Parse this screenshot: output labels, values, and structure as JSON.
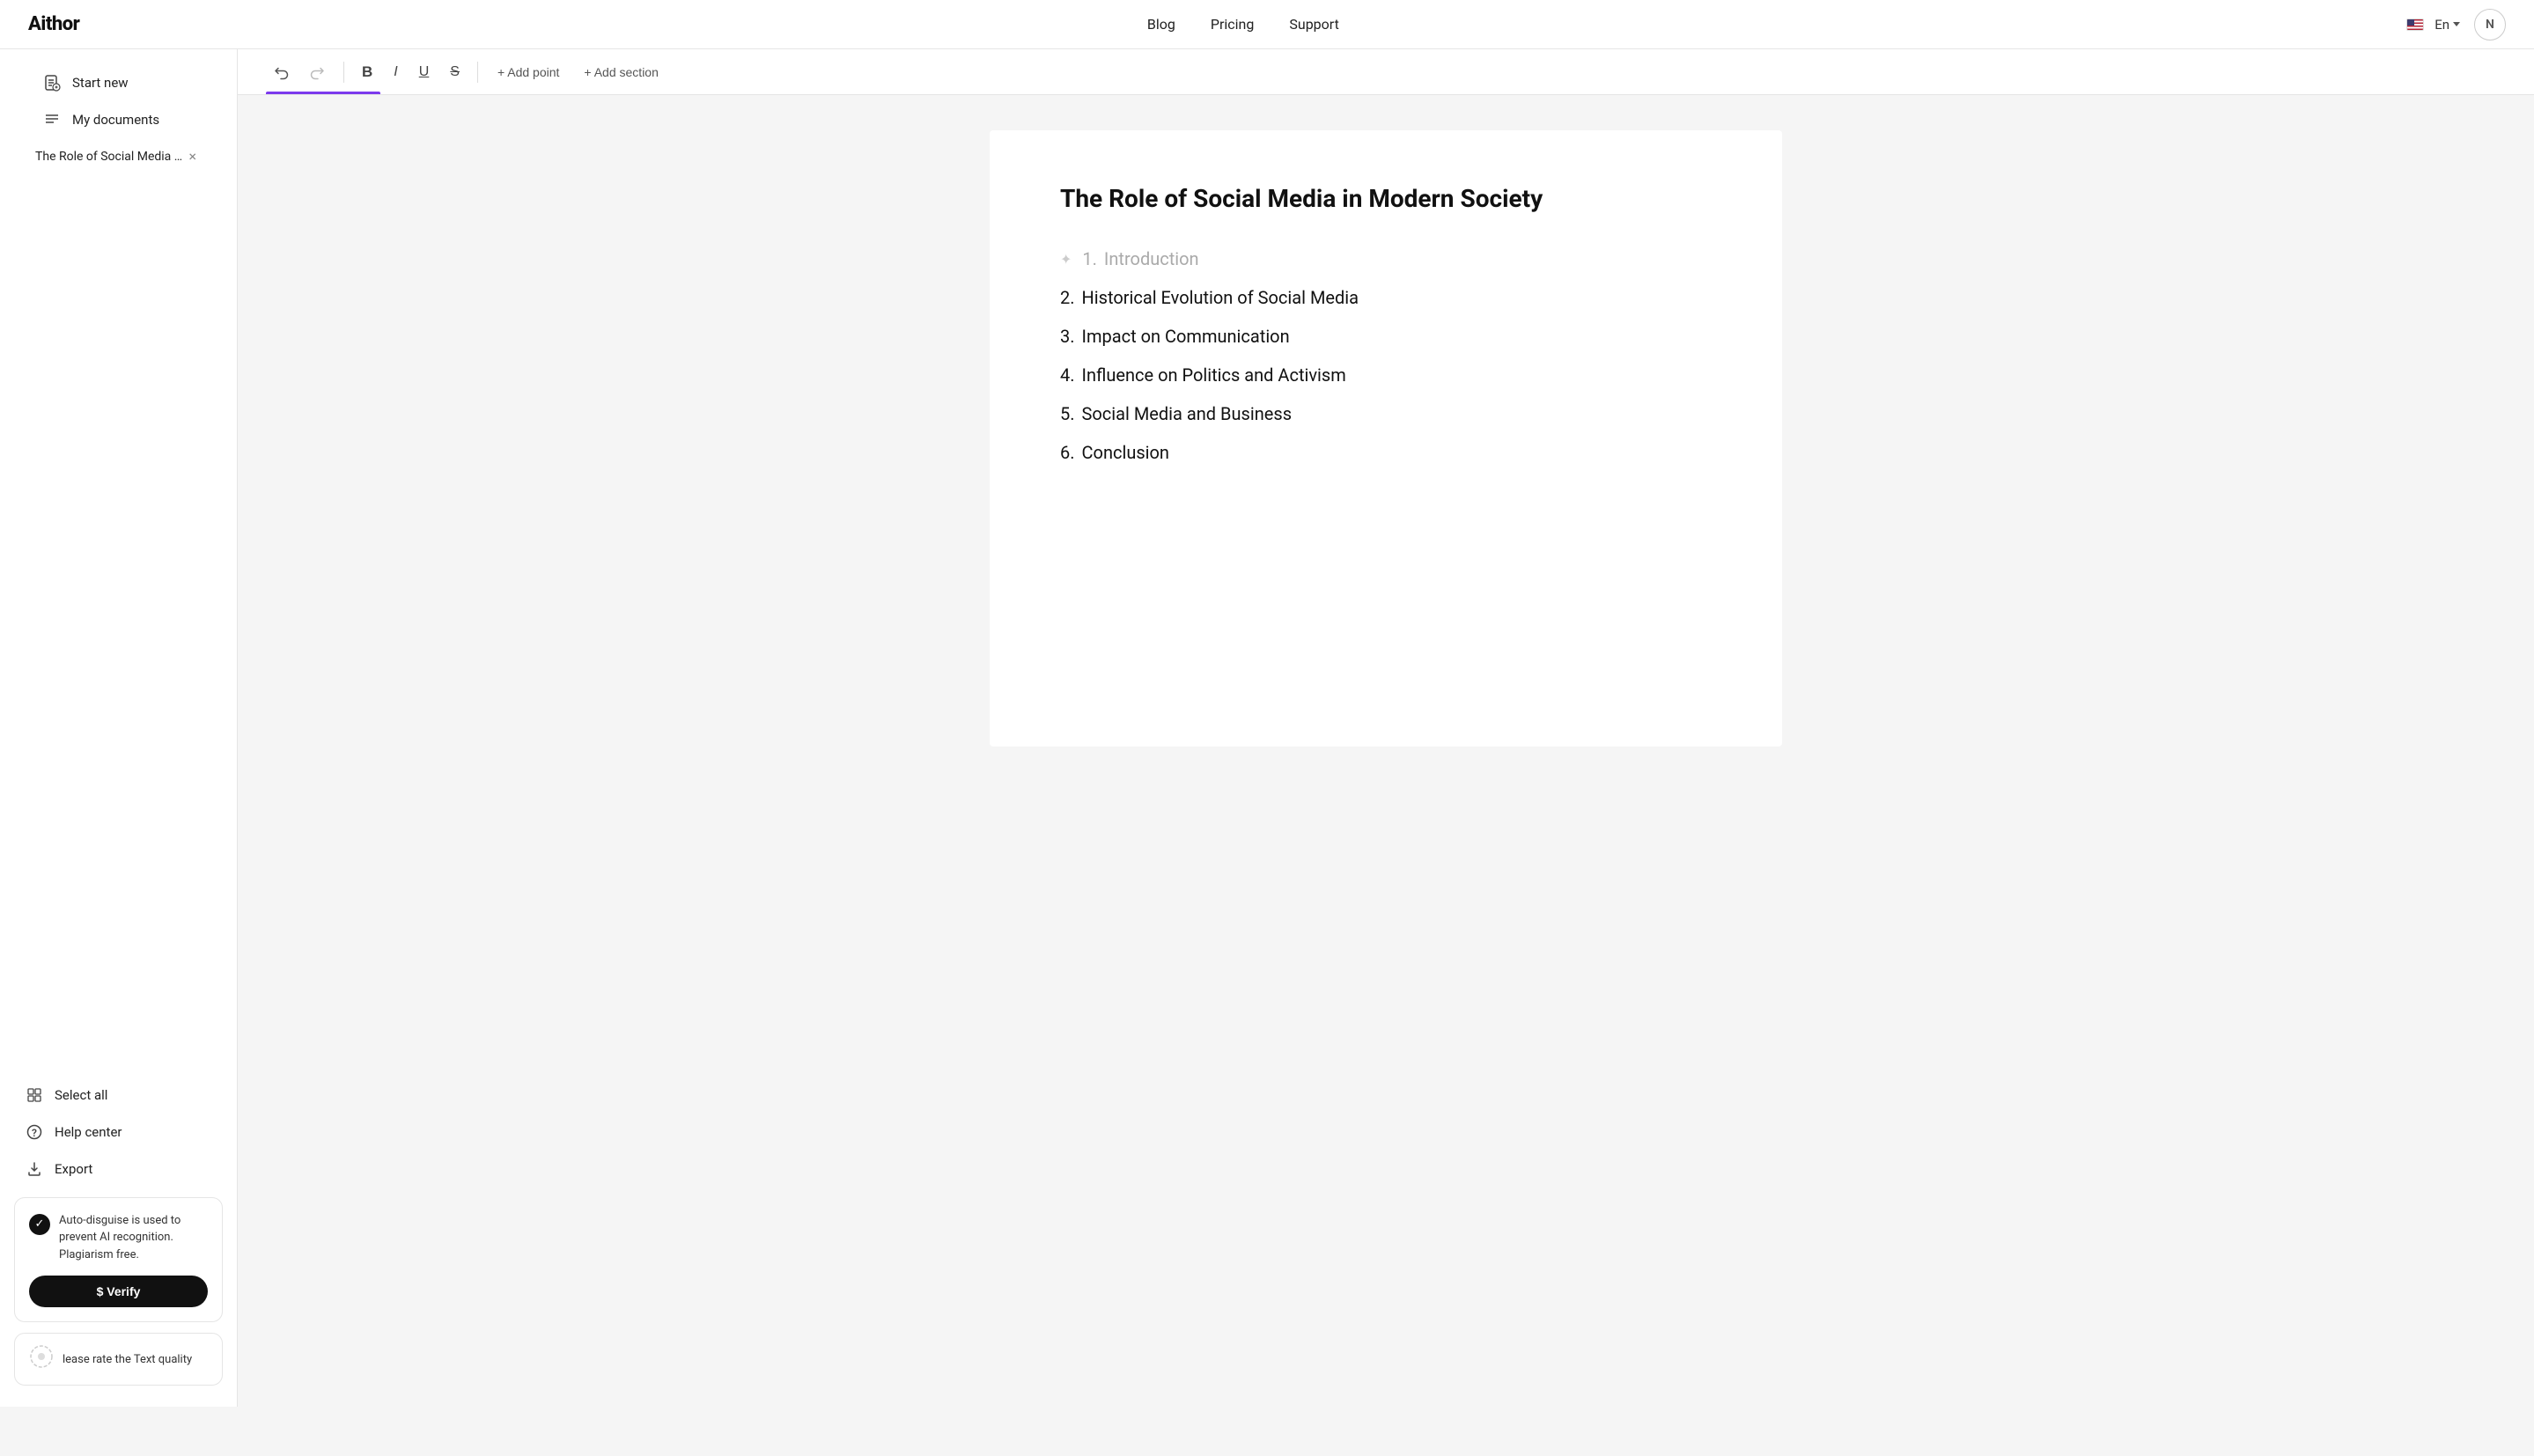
{
  "header": {
    "logo": "Aithor",
    "nav": [
      {
        "label": "Blog",
        "id": "blog"
      },
      {
        "label": "Pricing",
        "id": "pricing"
      },
      {
        "label": "Support",
        "id": "support"
      }
    ],
    "lang": "En",
    "user_initial": "N"
  },
  "sidebar": {
    "start_new_label": "Start new",
    "my_documents_label": "My documents",
    "open_doc_title": "The Role of Social Media i...",
    "select_all_label": "Select all",
    "help_center_label": "Help center",
    "export_label": "Export",
    "info_card": {
      "text": "Auto-disguise is used to prevent AI recognition. Plagiarism free.",
      "verify_btn": "$ Verify"
    },
    "rating_card": {
      "text": "lease rate the Text quality"
    }
  },
  "toolbar": {
    "undo_label": "↩",
    "redo_label": "↪",
    "bold_label": "B",
    "italic_label": "I",
    "underline_label": "U",
    "strikethrough_label": "S",
    "add_point_label": "+ Add point",
    "add_section_label": "+ Add section"
  },
  "document": {
    "title": "The Role of Social Media in Modern Society",
    "sections": [
      {
        "number": "1.",
        "label": "Introduction",
        "muted": true
      },
      {
        "number": "2.",
        "label": "Historical Evolution of Social Media",
        "muted": false
      },
      {
        "number": "3.",
        "label": "Impact on Communication",
        "muted": false
      },
      {
        "number": "4.",
        "label": "Influence on Politics and Activism",
        "muted": false
      },
      {
        "number": "5.",
        "label": "Social Media and Business",
        "muted": false
      },
      {
        "number": "6.",
        "label": "Conclusion",
        "muted": false
      }
    ]
  }
}
